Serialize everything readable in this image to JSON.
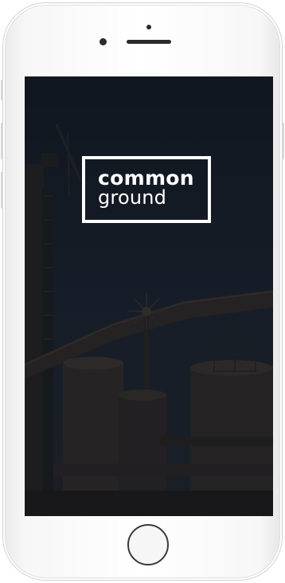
{
  "app": {
    "logo": {
      "line1": "common",
      "line2": "ground"
    }
  },
  "colors": {
    "screen_background": "#1c2430",
    "logo_text": "#ffffff",
    "device_frame": "#f4f4f4"
  },
  "icons": {
    "front_camera": "front-camera-icon",
    "speaker": "earpiece-speaker-icon",
    "home": "home-button-icon"
  }
}
